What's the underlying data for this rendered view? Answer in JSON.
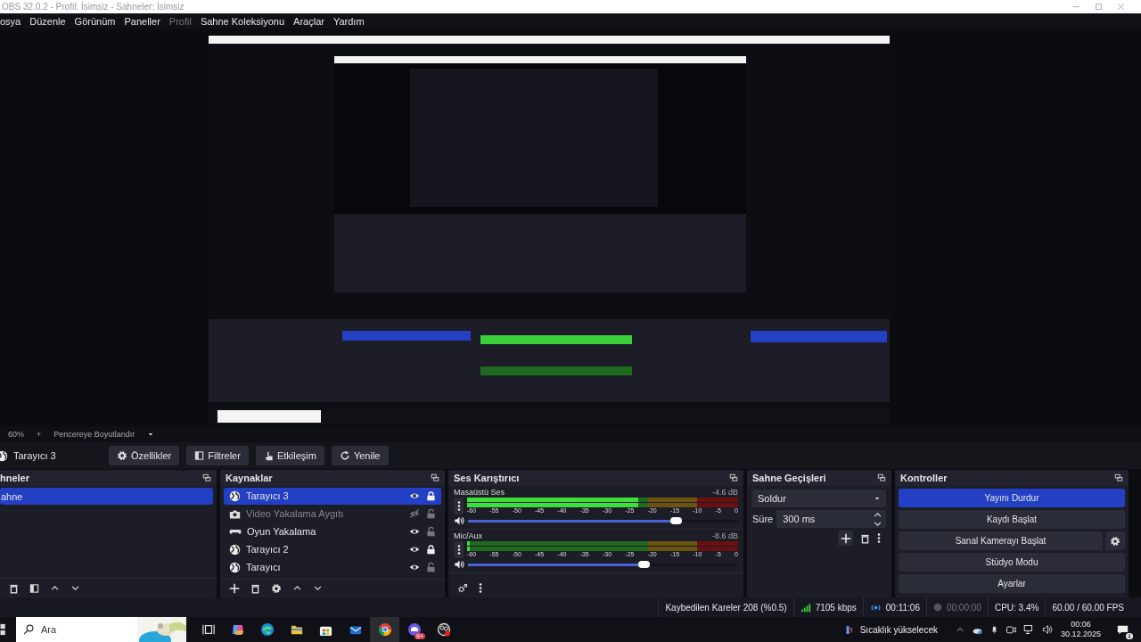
{
  "window": {
    "title": "OBS 32.0.2 - Profil: İsimsiz - Sahneler: İsimsiz"
  },
  "menu": [
    {
      "label": "osya",
      "disabled": false
    },
    {
      "label": "Düzenle",
      "disabled": false
    },
    {
      "label": "Görünüm",
      "disabled": false
    },
    {
      "label": "Paneller",
      "disabled": false
    },
    {
      "label": "Profil",
      "disabled": true
    },
    {
      "label": "Sahne Koleksiyonu",
      "disabled": false
    },
    {
      "label": "Araçlar",
      "disabled": false
    },
    {
      "label": "Yardım",
      "disabled": false
    }
  ],
  "zoom_bar": {
    "zoom": "60%",
    "plus": "+",
    "fit": "Pencereye Boyutlandır"
  },
  "source_toolbar": {
    "source": "Tarayıcı 3",
    "buttons": [
      {
        "kind": "gear",
        "label": "Özellikler"
      },
      {
        "kind": "filter",
        "label": "Filtreler"
      },
      {
        "kind": "hand",
        "label": "Etkileşim"
      },
      {
        "kind": "refresh",
        "label": "Yenile"
      }
    ]
  },
  "scenes": {
    "title": "hneler",
    "items": [
      {
        "label": "ahne",
        "selected": true
      }
    ]
  },
  "sources": {
    "title": "Kaynaklar",
    "items": [
      {
        "label": "Tarayıcı 3",
        "kind": "globe",
        "selected": true,
        "visible": true,
        "locked": true
      },
      {
        "label": "Video Yakalama Aygıtı",
        "kind": "camera",
        "selected": false,
        "visible": false,
        "locked": false
      },
      {
        "label": "Oyun Yakalama",
        "kind": "gamepad",
        "selected": false,
        "visible": true,
        "locked": false
      },
      {
        "label": "Tarayıcı 2",
        "kind": "globe",
        "selected": false,
        "visible": true,
        "locked": true
      },
      {
        "label": "Tarayıcı",
        "kind": "globe",
        "selected": false,
        "visible": true,
        "locked": false
      }
    ]
  },
  "mixer": {
    "title": "Ses Karıştırıcı",
    "channels": [
      {
        "name": "Masaüstü Ses",
        "reading": "-4.6 dB",
        "meter": {
          "level": 0.63
        },
        "volume": {
          "level": 0.77
        },
        "scale": [
          "-60",
          "-55",
          "-50",
          "-45",
          "-40",
          "-35",
          "-30",
          "-25",
          "-20",
          "-15",
          "-10",
          "-5",
          "0"
        ]
      },
      {
        "name": "Mic/Aux",
        "reading": "-8.6 dB",
        "meter": {
          "level": 0.01
        },
        "volume": {
          "level": 0.65
        },
        "scale": [
          "-60",
          "-55",
          "-50",
          "-45",
          "-40",
          "-35",
          "-30",
          "-25",
          "-20",
          "-15",
          "-10",
          "-5",
          "0"
        ]
      }
    ]
  },
  "transitions": {
    "title": "Sahne Geçişleri",
    "transition": "Soldur",
    "duration_label": "Süre",
    "duration": "300 ms"
  },
  "controls": {
    "title": "Kontroller",
    "buttons": [
      {
        "label": "Yayını Durdur",
        "on": true,
        "settings": false
      },
      {
        "label": "Kaydı Başlat",
        "on": false,
        "settings": false
      },
      {
        "label": "Sanal Kamerayı Başlat",
        "on": false,
        "settings": true
      },
      {
        "label": "Stüdyo Modu",
        "on": false,
        "settings": false
      },
      {
        "label": "Ayarlar",
        "on": false,
        "settings": false
      }
    ]
  },
  "status_bar": {
    "dropped": "Kaybedilen Kareler 208 (%0.5)",
    "bitrate": "7105 kbps",
    "stream_time": "00:11:06",
    "record_time": "00:00:00",
    "cpu": "CPU: 3.4%",
    "fps": "60.00 / 60.00 FPS"
  },
  "taskbar": {
    "search": "Ara",
    "apps": [
      {
        "kind": "taskview",
        "selected": false
      },
      {
        "kind": "copilot",
        "selected": false
      },
      {
        "kind": "edge",
        "selected": false
      },
      {
        "kind": "folder",
        "selected": false
      },
      {
        "kind": "store",
        "selected": false
      },
      {
        "kind": "mail",
        "selected": false
      },
      {
        "kind": "chrome",
        "selected": true
      },
      {
        "kind": "chat",
        "selected": false,
        "badge": "9+"
      },
      {
        "kind": "obs",
        "selected": false
      }
    ],
    "weather": "Sıcaklık yükselecek",
    "time": "00:06",
    "date": "30.12.2025",
    "notifications": "4"
  }
}
